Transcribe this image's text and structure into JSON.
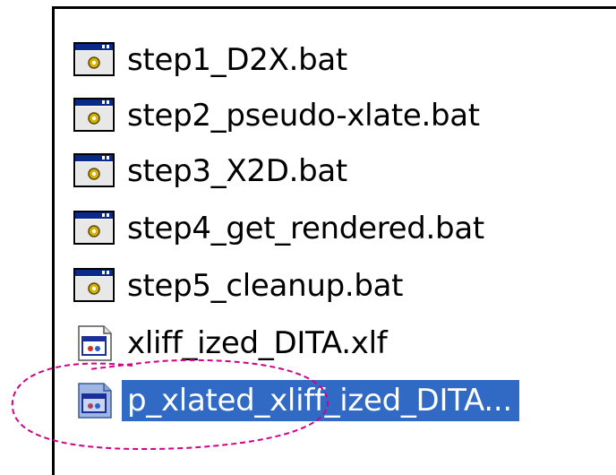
{
  "files": [
    {
      "name": "step1_D2X.bat",
      "icon": "batch-file-icon",
      "selected": false
    },
    {
      "name": "step2_pseudo-xlate.bat",
      "icon": "batch-file-icon",
      "selected": false
    },
    {
      "name": "step3_X2D.bat",
      "icon": "batch-file-icon",
      "selected": false
    },
    {
      "name": "step4_get_rendered.bat",
      "icon": "batch-file-icon",
      "selected": false
    },
    {
      "name": "step5_cleanup.bat",
      "icon": "batch-file-icon",
      "selected": false
    },
    {
      "name": "xliff_ized_DITA.xlf",
      "icon": "xlf-document-icon",
      "selected": false
    },
    {
      "name": "p_xlated_xliff_ized_DITA...",
      "icon": "xlf-document-icon",
      "selected": true
    }
  ],
  "colors": {
    "selection": "#316ac5",
    "annotation": "#d0008a"
  }
}
